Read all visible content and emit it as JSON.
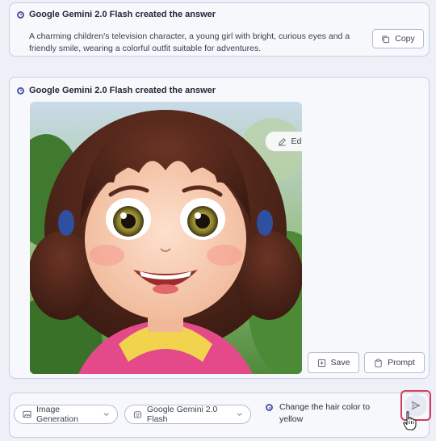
{
  "answer1": {
    "header": "Google Gemini 2.0 Flash created the answer",
    "text": "A charming children's television character, a young girl with bright, curious eyes and a friendly smile, wearing a colorful outfit suitable for adventures.",
    "copy_label": "Copy"
  },
  "answer2": {
    "header": "Google Gemini 2.0 Flash created the answer",
    "edit_label": "Edit",
    "save_label": "Save",
    "prompt_label": "Prompt"
  },
  "composer": {
    "mode_label": "Image Generation",
    "model_label": "Google Gemini 2.0 Flash",
    "input_text": "Change the hair color to yellow"
  },
  "colors": {
    "accent": "#4a55a8",
    "send_highlight": "#d63c5b"
  }
}
